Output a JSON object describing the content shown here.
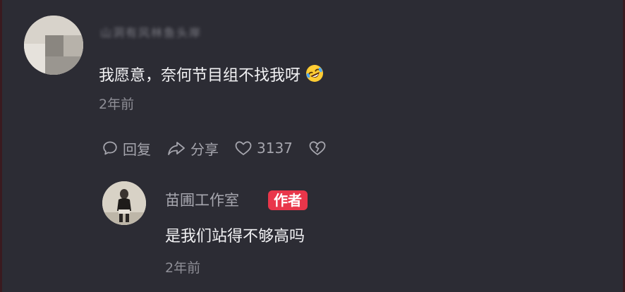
{
  "colors": {
    "background": "#2c2c34",
    "text_primary": "#f2f2f4",
    "text_secondary": "#8e8e96",
    "action_text": "#a5a5ad",
    "author_badge": "#e9364a"
  },
  "comment": {
    "username": "山洞有风林鱼头岸",
    "text": "我愿意，奈何节目组不找我呀",
    "emoji": "rolling-on-floor-laughing-icon",
    "time": "2年前",
    "actions": {
      "reply_label": "回复",
      "share_label": "分享",
      "like_count": "3137"
    }
  },
  "reply": {
    "username": "苗圃工作室",
    "badge": "作者",
    "text": "是我们站得不够高吗",
    "time": "2年前"
  }
}
